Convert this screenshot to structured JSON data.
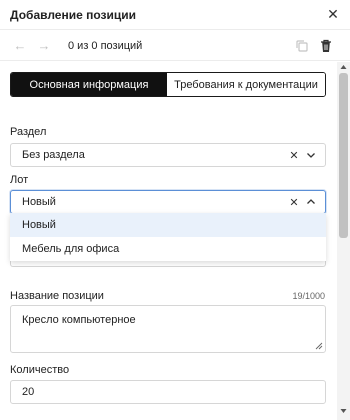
{
  "dialog": {
    "title": "Добавление позиции",
    "close_icon": "close-icon"
  },
  "toolbar": {
    "position_counter": "0 из 0 позиций",
    "prev_icon": "arrow-left-icon",
    "next_icon": "arrow-right-icon",
    "copy_icon": "copy-icon",
    "delete_icon": "trash-icon"
  },
  "tabs": [
    {
      "label": "Основная информация",
      "active": true
    },
    {
      "label": "Требования к документации",
      "active": false
    }
  ],
  "form": {
    "section": {
      "label": "Раздел",
      "value": "Без раздела"
    },
    "lot": {
      "label": "Лот",
      "value": "Новый",
      "options": [
        "Новый",
        "Мебель для офиса"
      ]
    },
    "position_name": {
      "label": "Название позиции",
      "value": "Кресло компьютерное",
      "char_count": "19/1000"
    },
    "quantity": {
      "label": "Количество",
      "value": "20"
    }
  },
  "colors": {
    "active_tab_bg": "#111111",
    "focus_border": "#5b8fd6",
    "option_highlight": "#e9f1fb"
  }
}
